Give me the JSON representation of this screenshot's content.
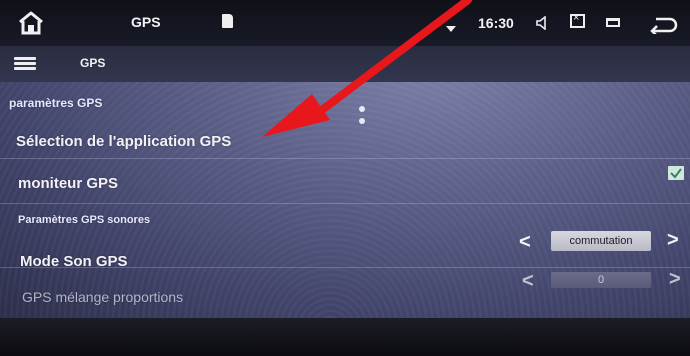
{
  "status_bar": {
    "app_title": "GPS",
    "clock": "16:30"
  },
  "toolbar": {
    "title": "GPS"
  },
  "sections": {
    "gps_settings_header": "paramètres GPS",
    "gps_app_selection": "Sélection de l'application GPS",
    "gps_monitor": "moniteur GPS",
    "gps_sound_header": "Paramètres GPS sonores",
    "gps_sound_mode": "Mode Son GPS",
    "gps_mix": "GPS mélange proportions"
  },
  "controls": {
    "gps_monitor_checked": true,
    "sound_mode_value": "commutation",
    "mix_value": "0"
  },
  "icons": [
    "home-icon",
    "sd-card-icon",
    "wifi-icon",
    "volume-icon",
    "screenshot-icon",
    "window-icon",
    "back-icon",
    "menu-icon",
    "check-icon",
    "chevron-left-icon",
    "chevron-right-icon"
  ],
  "colors": {
    "accent_arrow": "#e8171c",
    "checkbox": "#cfe9de"
  }
}
